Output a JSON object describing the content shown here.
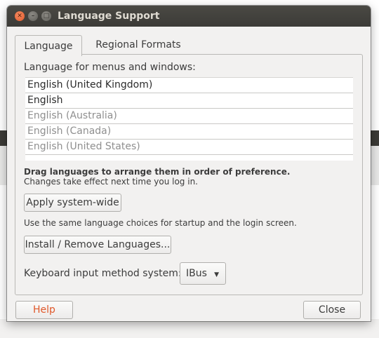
{
  "window": {
    "title": "Language Support"
  },
  "tabs": [
    {
      "label": "Language",
      "active": true
    },
    {
      "label": "Regional Formats",
      "active": false
    }
  ],
  "language_tab": {
    "heading": "Language for menus and windows:",
    "languages": [
      {
        "label": "English (United Kingdom)",
        "active": true
      },
      {
        "label": "English",
        "active": true
      },
      {
        "label": "English (Australia)",
        "active": false
      },
      {
        "label": "English (Canada)",
        "active": false
      },
      {
        "label": "English (United States)",
        "active": false
      }
    ],
    "hint_bold": "Drag languages to arrange them in order of preference.",
    "hint": "Changes take effect next time you log in.",
    "apply_label": "Apply system-wide",
    "apply_description": "Use the same language choices for startup and the login screen.",
    "install_label": "Install / Remove Languages...",
    "keyboard_label": "Keyboard input method system:",
    "keyboard_value": "IBus"
  },
  "footer": {
    "help_label": "Help",
    "close_label": "Close"
  },
  "colors": {
    "titlebar": "#3c3b37",
    "window_bg": "#f2f1f0",
    "close_button": "#e15a2b",
    "help_text": "#e0582a"
  }
}
